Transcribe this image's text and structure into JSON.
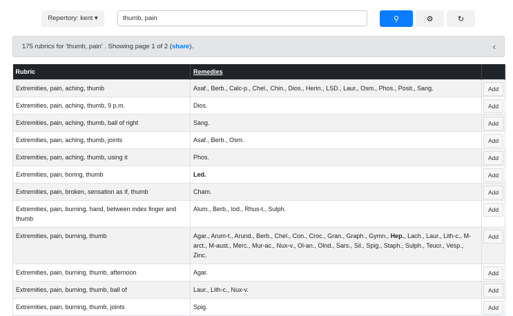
{
  "toolbar": {
    "repertory_label": "Repertory: kent ▾",
    "search_value": "thumb, pain",
    "search_icon": "search-icon",
    "settings_icon": "gear-icon",
    "loading_icon": "spinner-icon"
  },
  "results": {
    "summary": "175 rubrics for 'thumb, pain' . Showing page 1 of 2 (",
    "share_link": "share",
    "summary_end": ").",
    "collapse_icon": "chevron-left-icon"
  },
  "table": {
    "headers": {
      "rubric": "Rubric",
      "remedies": "Remedies"
    },
    "add_label": "Add",
    "rows": [
      {
        "rubric": "Extremities, pain, aching, thumb",
        "remedies": [
          {
            "t": "Asaf., Berb., Calc-p., Chel., Chin., Dios., Herin., LSD., Laur., Osm., Phos., Posit., Sang."
          }
        ]
      },
      {
        "rubric": "Extremities, pain, aching, thumb, 9 p.m.",
        "remedies": [
          {
            "t": "Dios."
          }
        ]
      },
      {
        "rubric": "Extremities, pain, aching, thumb, ball of right",
        "remedies": [
          {
            "t": "Sang."
          }
        ]
      },
      {
        "rubric": "Extremities, pain, aching, thumb, joints",
        "remedies": [
          {
            "t": "Asaf., Berb., Osm."
          }
        ]
      },
      {
        "rubric": "Extremities, pain, aching, thumb, using it",
        "remedies": [
          {
            "t": "Phos."
          }
        ]
      },
      {
        "rubric": "Extremities, pain, boring, thumb",
        "remedies": [
          {
            "t": "Led.",
            "b": true
          }
        ]
      },
      {
        "rubric": "Extremities, pain, broken, sensation as if, thumb",
        "remedies": [
          {
            "t": "Cham."
          }
        ]
      },
      {
        "rubric": "Extremities, pain, burning, hand, between index finger and thumb",
        "remedies": [
          {
            "t": "Alum., Berb., Iod., Rhus-t., Sulph."
          }
        ]
      },
      {
        "rubric": "Extremities, pain, burning, thumb",
        "remedies": [
          {
            "t": "Agar., Arum-t., Arund., Berb., Chel., Con., Croc., Gran., Graph., Gymn., "
          },
          {
            "t": "Hep.",
            "b": true
          },
          {
            "t": ", Lach., Laur., Lith-c., M-arct., M-aust., Merc., Mur-ac., Nux-v., Ol-an., Olnd., Sars., Sil., Spig., Staph., Sulph., Teucr., Vesp., Zinc."
          }
        ]
      },
      {
        "rubric": "Extremities, pain, burning, thumb, afternoon",
        "remedies": [
          {
            "t": "Agar."
          }
        ]
      },
      {
        "rubric": "Extremities, pain, burning, thumb, ball of",
        "remedies": [
          {
            "t": "Laur., Lith-c., Nux-v."
          }
        ]
      },
      {
        "rubric": "Extremities, pain, burning, thumb, joints",
        "remedies": [
          {
            "t": "Spig."
          }
        ]
      }
    ]
  }
}
